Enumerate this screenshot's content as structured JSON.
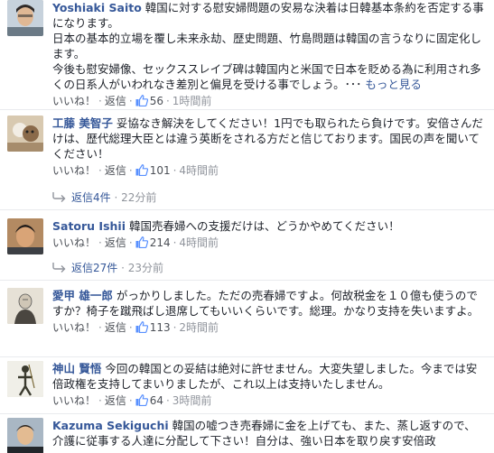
{
  "comments": [
    {
      "author": "Yoshiaki Saito",
      "paragraphs": [
        "韓国に対する慰安婦問題の安易な決着は日韓基本条約を否定する事になります。",
        "日本の基本的立場を覆し未来永劫、歴史問題、竹島問題は韓国の言うなりに固定化します。",
        "今後も慰安婦像、セックススレイブ碑は韓国内と米国で日本を貶める為に利用され多くの日系人がいわれなき差別と偏見を受ける事でしょう。･･･"
      ],
      "see_more": "もっと見る",
      "like": "いいね！",
      "reply": "返信",
      "likes": "56",
      "time": "1時間前"
    },
    {
      "author": "工藤 美智子",
      "paragraphs": [
        "妥協なき解決をしてください！1円でも取られたら負けです。安倍さんだけは、歴代総理大臣とは違う英断をされる方だと信じております。国民の声を聞いてください！"
      ],
      "like": "いいね！",
      "reply": "返信",
      "likes": "101",
      "time": "4時間前",
      "replies_label": "返信4件",
      "replies_time": "22分前"
    },
    {
      "author": "Satoru Ishii",
      "paragraphs": [
        "韓国売春婦への支援だけは、どうかやめてください！"
      ],
      "like": "いいね！",
      "reply": "返信",
      "likes": "214",
      "time": "4時間前",
      "replies_label": "返信27件",
      "replies_time": "23分前"
    },
    {
      "author": "愛甲 雄一郎",
      "paragraphs": [
        "がっかりしました。ただの売春婦ですよ。何故税金を１０億も使うのですか？椅子を蹴飛ばし退席してもいいくらいです。総理。かなり支持を失いますよ。"
      ],
      "like": "いいね！",
      "reply": "返信",
      "likes": "113",
      "time": "2時間前"
    },
    {
      "author": "神山 賢悟",
      "paragraphs": [
        "今回の韓国との妥結は絶対に許せません。大変失望しました。今までは安倍政権を支持してまいりましたが、これ以上は支持いたしません。"
      ],
      "like": "いいね！",
      "reply": "返信",
      "likes": "64",
      "time": "3時間前"
    },
    {
      "author": "Kazuma Sekiguchi",
      "paragraphs": [
        "韓国の嘘つき売春婦に金を上げても、また、蒸し返すので、介護に従事する人達に分配して下さい！自分は、強い日本を取り戻す安倍政"
      ]
    }
  ],
  "icons": {
    "like": "thumbs-up-icon",
    "replies": "reply-arrow-icon"
  },
  "colors": {
    "author_link": "#365899",
    "meta_gray": "#90949c",
    "like_blue": "#5890ff"
  }
}
